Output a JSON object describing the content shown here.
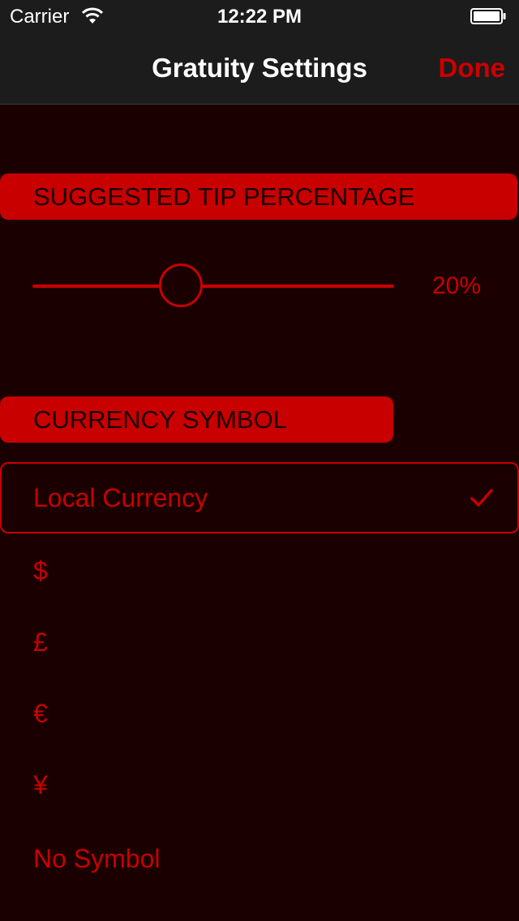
{
  "status_bar": {
    "carrier": "Carrier",
    "time": "12:22 PM"
  },
  "nav": {
    "title": "Gratuity Settings",
    "done_label": "Done"
  },
  "tip_section": {
    "header": "SUGGESTED TIP PERCENTAGE",
    "value_label": "20%",
    "slider_fraction": 0.41
  },
  "currency_section": {
    "header": "CURRENCY SYMBOL",
    "options": [
      {
        "label": "Local Currency",
        "selected": true
      },
      {
        "label": "$",
        "selected": false
      },
      {
        "label": "£",
        "selected": false
      },
      {
        "label": "€",
        "selected": false
      },
      {
        "label": "¥",
        "selected": false
      },
      {
        "label": "No Symbol",
        "selected": false
      }
    ]
  },
  "icons": {
    "wifi": "wifi-icon",
    "battery": "battery-icon",
    "checkmark": "checkmark-icon"
  },
  "colors": {
    "accent": "#c80000",
    "background": "#1a0000",
    "bar": "#1c1c1c"
  }
}
